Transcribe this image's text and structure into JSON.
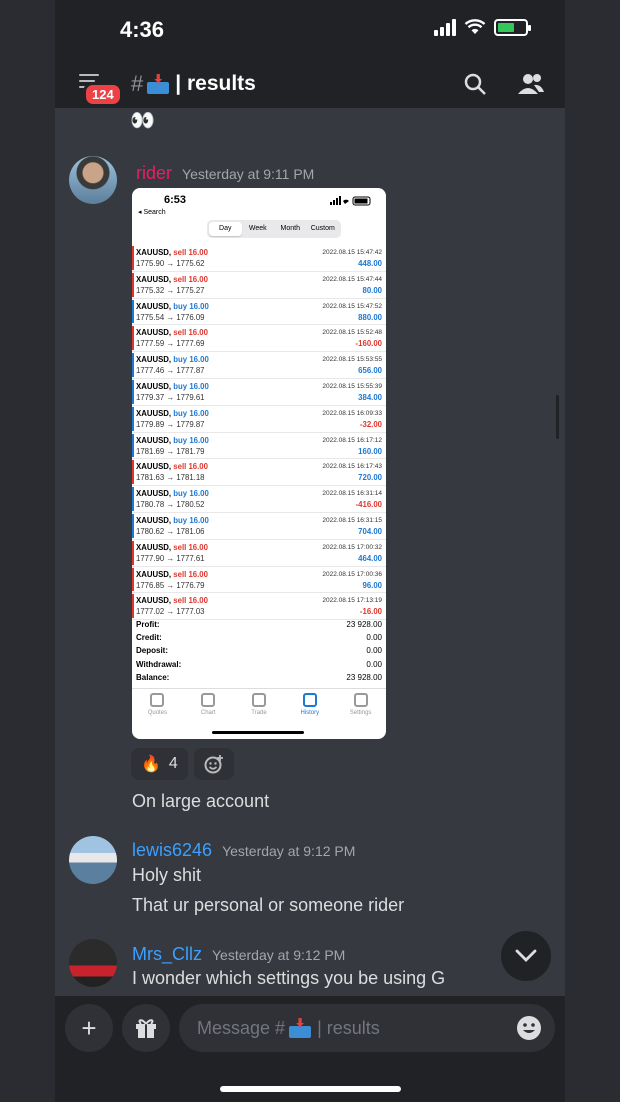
{
  "status": {
    "time": "4:36"
  },
  "header": {
    "notif_count": "124",
    "channel": "results"
  },
  "messages": [
    {
      "user": "rider",
      "time": "Yesterday at 9:11 PM",
      "user_color": "#e91e63"
    },
    {
      "user": "lewis6246",
      "time": "Yesterday at 9:12 PM",
      "user_color": "#3ba0ff",
      "lines": [
        "Holy shit",
        "That ur personal or someone rider"
      ]
    },
    {
      "user": "Mrs_Cllz",
      "time": "Yesterday at 9:12 PM",
      "user_color": "#3ba0ff",
      "lines": [
        "I wonder which settings you be using G"
      ]
    }
  ],
  "caption": "On large account",
  "reaction": {
    "emoji": "🔥",
    "count": "4"
  },
  "screenshot": {
    "time": "6:53",
    "back": "◂ Search",
    "tabs": [
      "Day",
      "Week",
      "Month",
      "Custom"
    ],
    "active_tab": "Day",
    "trades": [
      {
        "sym": "XAUUSD,",
        "side": "sell",
        "vol": "16.00",
        "open": "1775.90",
        "close": "1775.62",
        "date": "2022.08.15 15:47:42",
        "profit": "448.00"
      },
      {
        "sym": "XAUUSD,",
        "side": "sell",
        "vol": "16.00",
        "open": "1775.32",
        "close": "1775.27",
        "date": "2022.08.15 15:47:44",
        "profit": "80.00"
      },
      {
        "sym": "XAUUSD,",
        "side": "buy",
        "vol": "16.00",
        "open": "1775.54",
        "close": "1776.09",
        "date": "2022.08.15 15:47:52",
        "profit": "880.00"
      },
      {
        "sym": "XAUUSD,",
        "side": "sell",
        "vol": "16.00",
        "open": "1777.59",
        "close": "1777.69",
        "date": "2022.08.15 15:52:48",
        "profit": "-160.00"
      },
      {
        "sym": "XAUUSD,",
        "side": "buy",
        "vol": "16.00",
        "open": "1777.46",
        "close": "1777.87",
        "date": "2022.08.15 15:53:55",
        "profit": "656.00"
      },
      {
        "sym": "XAUUSD,",
        "side": "buy",
        "vol": "16.00",
        "open": "1779.37",
        "close": "1779.61",
        "date": "2022.08.15 15:55:39",
        "profit": "384.00"
      },
      {
        "sym": "XAUUSD,",
        "side": "buy",
        "vol": "16.00",
        "open": "1779.89",
        "close": "1779.87",
        "date": "2022.08.15 16:09:33",
        "profit": "-32.00"
      },
      {
        "sym": "XAUUSD,",
        "side": "buy",
        "vol": "16.00",
        "open": "1781.69",
        "close": "1781.79",
        "date": "2022.08.15 16:17:12",
        "profit": "160.00"
      },
      {
        "sym": "XAUUSD,",
        "side": "sell",
        "vol": "16.00",
        "open": "1781.63",
        "close": "1781.18",
        "date": "2022.08.15 16:17:43",
        "profit": "720.00"
      },
      {
        "sym": "XAUUSD,",
        "side": "buy",
        "vol": "16.00",
        "open": "1780.78",
        "close": "1780.52",
        "date": "2022.08.15 16:31:14",
        "profit": "-416.00"
      },
      {
        "sym": "XAUUSD,",
        "side": "buy",
        "vol": "16.00",
        "open": "1780.62",
        "close": "1781.06",
        "date": "2022.08.15 16:31:15",
        "profit": "704.00"
      },
      {
        "sym": "XAUUSD,",
        "side": "sell",
        "vol": "16.00",
        "open": "1777.90",
        "close": "1777.61",
        "date": "2022.08.15 17:00:32",
        "profit": "464.00"
      },
      {
        "sym": "XAUUSD,",
        "side": "sell",
        "vol": "16.00",
        "open": "1776.85",
        "close": "1776.79",
        "date": "2022.08.15 17:00:36",
        "profit": "96.00"
      },
      {
        "sym": "XAUUSD,",
        "side": "sell",
        "vol": "16.00",
        "open": "1777.02",
        "close": "1777.03",
        "date": "2022.08.15 17:13:19",
        "profit": "-16.00"
      }
    ],
    "summary": [
      {
        "label": "Profit:",
        "value": "23 928.00"
      },
      {
        "label": "Credit:",
        "value": "0.00"
      },
      {
        "label": "Deposit:",
        "value": "0.00"
      },
      {
        "label": "Withdrawal:",
        "value": "0.00"
      },
      {
        "label": "Balance:",
        "value": "23 928.00"
      }
    ],
    "nav": [
      "Quotes",
      "Chart",
      "Trade",
      "History",
      "Settings"
    ],
    "active_nav": "History"
  },
  "composer": {
    "placeholder_prefix": "Message #",
    "placeholder_channel": "| results"
  }
}
